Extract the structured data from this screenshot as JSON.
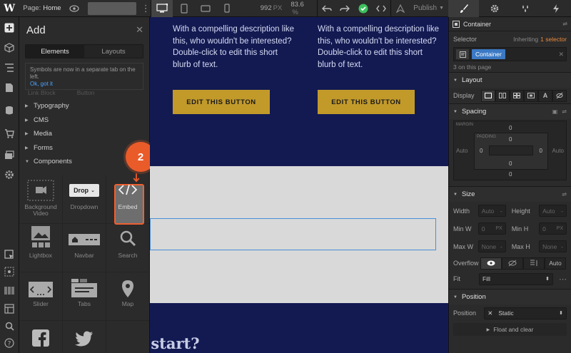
{
  "topbar": {
    "page_prefix": "Page:",
    "page_name": "Home",
    "width_value": "992",
    "width_unit": "PX",
    "zoom_value": "83.6",
    "zoom_unit": "%",
    "publish_label": "Publish"
  },
  "add_panel": {
    "title": "Add",
    "tabs": [
      "Elements",
      "Layouts"
    ],
    "note_text": "Symbols are now in a separate tab on the left.",
    "note_link": "Ok, got it",
    "cut_off": [
      "Link Block",
      "Button"
    ],
    "categories": [
      "Typography",
      "CMS",
      "Media",
      "Forms",
      "Components"
    ],
    "components": [
      {
        "label": "Background Video",
        "icon": "background-video-icon"
      },
      {
        "label": "Dropdown",
        "icon": "dropdown-icon",
        "icon_text": "Drop"
      },
      {
        "label": "Embed",
        "icon": "embed-code-icon"
      },
      {
        "label": "Lightbox",
        "icon": "lightbox-icon"
      },
      {
        "label": "Navbar",
        "icon": "navbar-icon"
      },
      {
        "label": "Search",
        "icon": "search-icon"
      },
      {
        "label": "Slider",
        "icon": "slider-icon"
      },
      {
        "label": "Tabs",
        "icon": "tabs-icon"
      },
      {
        "label": "Map",
        "icon": "map-pin-icon"
      },
      {
        "label": "",
        "icon": "facebook-icon"
      },
      {
        "label": "",
        "icon": "twitter-icon"
      }
    ],
    "step_badge": "2"
  },
  "canvas": {
    "description_1": "With a compelling description like this, who wouldn't be interested? Double-click to edit this short blurb of text.",
    "description_2": "With a compelling description like this, who wouldn't be interested? Double-click to edit this short blurb of text.",
    "button_1": "EDIT THIS BUTTON",
    "button_2": "EDIT THIS BUTTON",
    "heading_fragment": "o start?"
  },
  "style_panel": {
    "element_type": "Container",
    "selector_label": "Selector",
    "inheriting_text": "Inheriting",
    "inheriting_count": "1 selector",
    "selector_chip": "Container",
    "on_page": "3 on this page",
    "layout": {
      "title": "Layout",
      "display_label": "Display"
    },
    "spacing": {
      "title": "Spacing",
      "margin_label": "MARGIN",
      "padding_label": "PADDING",
      "margin": {
        "top": "0",
        "right": "Auto",
        "bottom": "0",
        "left": "Auto"
      },
      "padding": {
        "top": "0",
        "right": "0",
        "bottom": "0",
        "left": "0"
      }
    },
    "size": {
      "title": "Size",
      "width_label": "Width",
      "width_value": "Auto",
      "height_label": "Height",
      "height_value": "Auto",
      "min_w_label": "Min W",
      "min_w_value": "0",
      "min_w_unit": "PX",
      "min_h_label": "Min H",
      "min_h_value": "0",
      "min_h_unit": "PX",
      "max_w_label": "Max W",
      "max_w_value": "None",
      "max_h_label": "Max H",
      "max_h_value": "None",
      "overflow_label": "Overflow",
      "overflow_auto": "Auto",
      "fit_label": "Fit",
      "fit_value": "Fill"
    },
    "position": {
      "title": "Position",
      "position_label": "Position",
      "position_value": "Static",
      "float_label": "Float and clear"
    }
  },
  "colors": {
    "accent": "#4a90d9",
    "highlight": "#ea5b2a",
    "canvas_bg": "#131a52",
    "button_gold": "#c29a2a",
    "publish_check": "#3fbf5f"
  }
}
